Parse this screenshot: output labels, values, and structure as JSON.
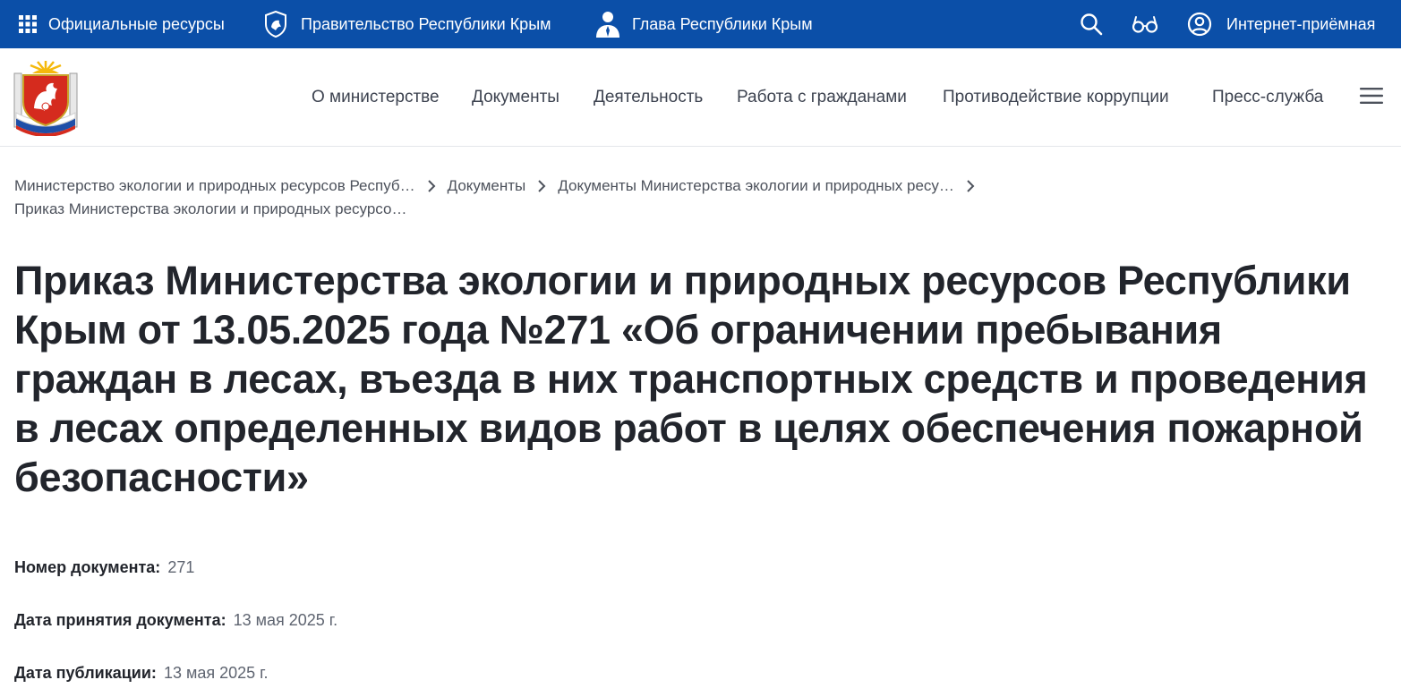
{
  "topbar": {
    "official_resources": "Официальные ресурсы",
    "government": "Правительство Республики Крым",
    "head": "Глава Республики Крым",
    "reception": "Интернет-приёмная",
    "icons": [
      "grid-icon",
      "search-icon",
      "glasses-icon",
      "user-circle-icon"
    ],
    "background": "#0b4fa8"
  },
  "nav": {
    "items": [
      "О министерстве",
      "Документы",
      "Деятельность",
      "Работа с гражданами",
      "Противодействие коррупции",
      "Пресс-служба"
    ]
  },
  "breadcrumbs": [
    "Министерство экологии и природных ресурсов Респуб…",
    "Документы",
    "Документы Министерства экологии и природных ресу…",
    "Приказ Министерства экологии и природных ресурсо…"
  ],
  "page": {
    "title": "Приказ Министерства экологии и природных ресурсов Республики Крым от 13.05.2025 года №271 «Об ограничении пребывания граждан в лесах, въезда в них транспортных средств и проведения в лесах определенных видов работ в целях обеспечения пожарной безопасности»"
  },
  "meta": {
    "number_label": "Номер документа:",
    "number_value": "271",
    "adopted_label": "Дата принятия документа:",
    "adopted_value": "13 мая 2025 г.",
    "published_label": "Дата публикации:",
    "published_value": "13 мая 2025 г."
  }
}
